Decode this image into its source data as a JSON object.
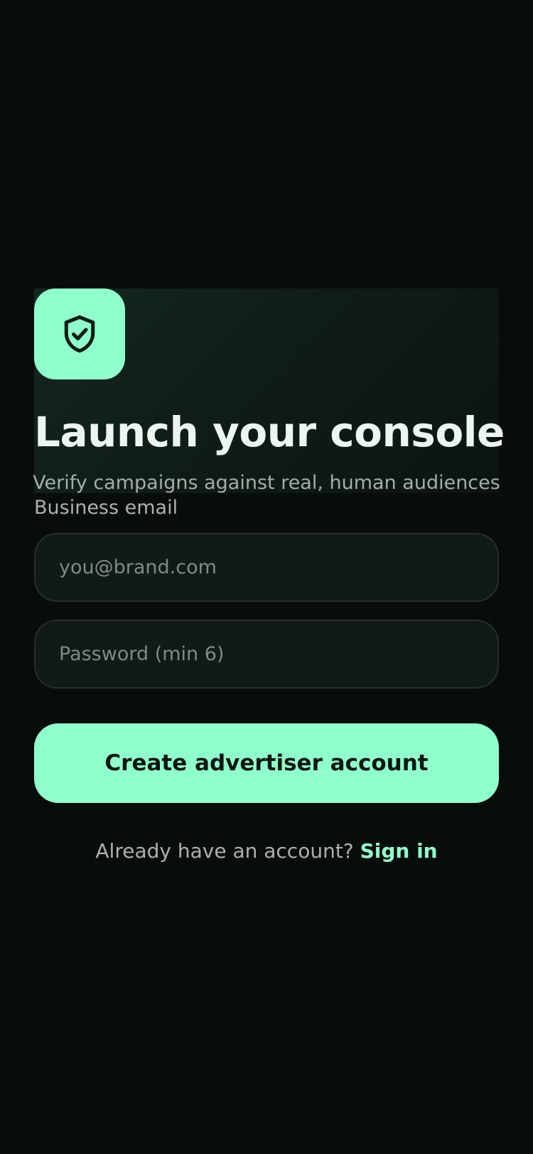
{
  "hero": {
    "logo_icon": "shield-check-icon",
    "title": "Launch your console",
    "subtitle": "Verify campaigns against real, human audiences"
  },
  "form": {
    "email_label": "Business email",
    "email_placeholder": "you@brand.com",
    "email_value": "",
    "password_placeholder": "Password (min 6)",
    "password_value": "",
    "submit_label": "Create advertiser account"
  },
  "footer": {
    "prompt": "Already have an account?",
    "link_label": "Sign in"
  },
  "colors": {
    "accent": "#8fffcb",
    "background": "#080d0b",
    "field_background": "#121a17"
  }
}
